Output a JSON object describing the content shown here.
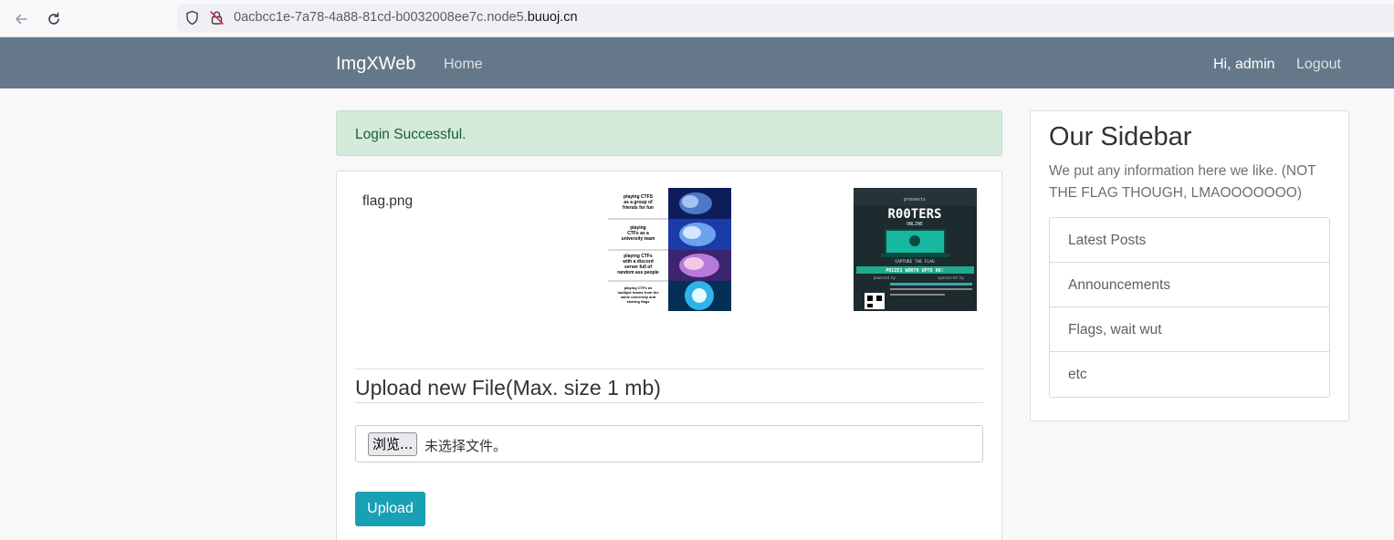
{
  "browser": {
    "url_prefix": "0acbcc1e-7a78-4a88-81cd-b0032008ee7c.node5.",
    "url_domain": "buuoj.cn"
  },
  "navbar": {
    "brand": "ImgXWeb",
    "home": "Home",
    "user": "Hi, admin",
    "logout": "Logout",
    "color": "#647889"
  },
  "alert": {
    "text": "Login Successful.",
    "color": "#d4ebdb"
  },
  "files": {
    "name": "flag.png",
    "images": [
      {
        "name": "meme-image",
        "captions": [
          "playing CTFS as a group of friends for fun",
          "playing CTFs as a university team",
          "playing CTFs with a discord server full of random ass people",
          "playing CTFs as multiple teams from the same university and sharing flags"
        ]
      },
      {
        "name": "rooters-poster-image",
        "texts": [
          "presents",
          "R00TERS",
          "ONLINE",
          "CAPTURE THE FLAG",
          "PRIZES WORTH UPTO 8K!",
          "powered by",
          "sponsored by"
        ]
      }
    ]
  },
  "upload": {
    "title": "Upload new File(Max. size 1 mb)",
    "browse": "浏览...",
    "no_file": "未选择文件。",
    "button": "Upload",
    "button_color": "#18a0b4"
  },
  "sidebar": {
    "title": "Our Sidebar",
    "description": "We put any information here we like. (NOT THE FLAG THOUGH, LMAOOOOOOO)",
    "items": [
      {
        "label": "Latest Posts"
      },
      {
        "label": "Announcements"
      },
      {
        "label": "Flags, wait wut"
      },
      {
        "label": "etc"
      }
    ]
  }
}
